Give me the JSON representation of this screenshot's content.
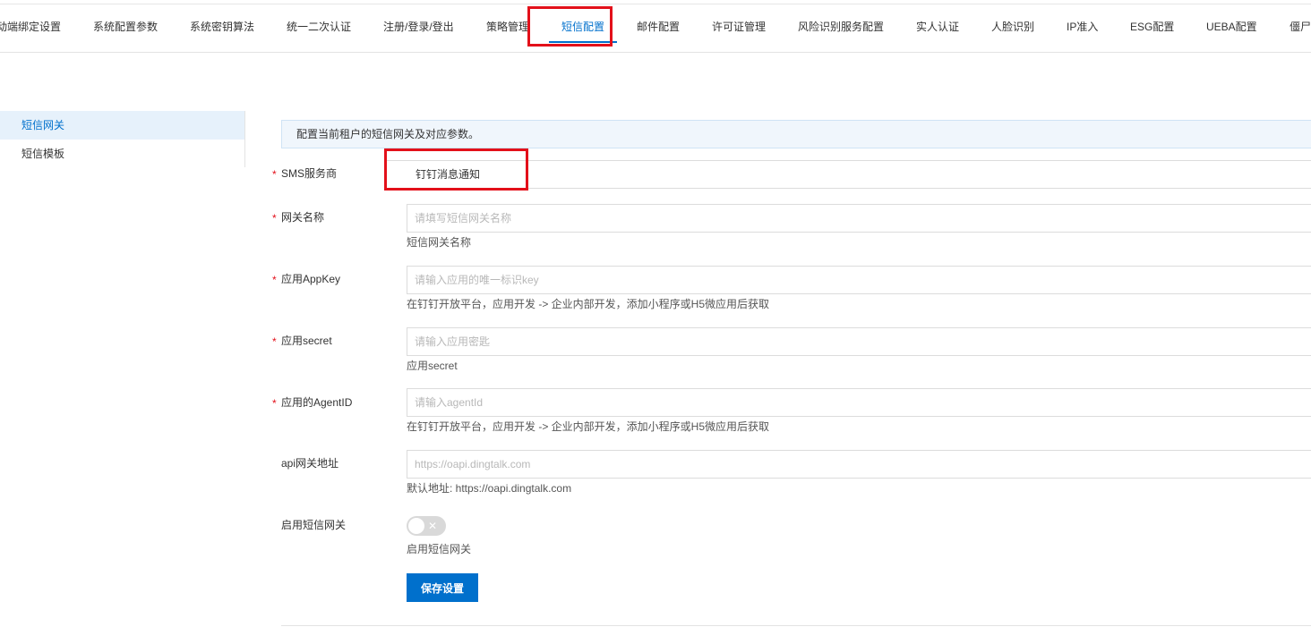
{
  "tabs": [
    {
      "label": "动端绑定设置"
    },
    {
      "label": "系统配置参数"
    },
    {
      "label": "系统密钥算法"
    },
    {
      "label": "统一二次认证"
    },
    {
      "label": "注册/登录/登出"
    },
    {
      "label": "策略管理"
    },
    {
      "label": "短信配置"
    },
    {
      "label": "邮件配置"
    },
    {
      "label": "许可证管理"
    },
    {
      "label": "风险识别服务配置"
    },
    {
      "label": "实人认证"
    },
    {
      "label": "人脸识别"
    },
    {
      "label": "IP准入"
    },
    {
      "label": "ESG配置"
    },
    {
      "label": "UEBA配置"
    },
    {
      "label": "僵尸"
    }
  ],
  "active_tab": "短信配置",
  "sidebar": {
    "items": [
      {
        "label": "短信网关",
        "active": true
      },
      {
        "label": "短信模板",
        "active": false
      }
    ]
  },
  "notice": "配置当前租户的短信网关及对应参数。",
  "form": {
    "provider": {
      "label": "SMS服务商",
      "value": "钉钉消息通知",
      "required": true
    },
    "gateway_name": {
      "label": "网关名称",
      "placeholder": "请填写短信网关名称",
      "hint": "短信网关名称",
      "required": true
    },
    "app_key": {
      "label": "应用AppKey",
      "placeholder": "请输入应用的唯一标识key",
      "hint": "在钉钉开放平台，应用开发 -> 企业内部开发，添加小程序或H5微应用后获取",
      "required": true
    },
    "app_secret": {
      "label": "应用secret",
      "placeholder": "请输入应用密匙",
      "hint": "应用secret",
      "required": true
    },
    "agent_id": {
      "label": "应用的AgentID",
      "placeholder": "请输入agentId",
      "hint": "在钉钉开放平台，应用开发 -> 企业内部开发，添加小程序或H5微应用后获取",
      "required": true
    },
    "api_gateway": {
      "label": "api网关地址",
      "placeholder": "https://oapi.dingtalk.com",
      "hint": "默认地址: https://oapi.dingtalk.com",
      "required": false
    },
    "enable": {
      "label": "启用短信网关",
      "hint": "启用短信网关",
      "enabled": false,
      "off_symbol": "✕"
    }
  },
  "save_label": "保存设置",
  "colors": {
    "accent": "#0070cc",
    "highlight": "#e3101a",
    "required": "#e3101a"
  }
}
